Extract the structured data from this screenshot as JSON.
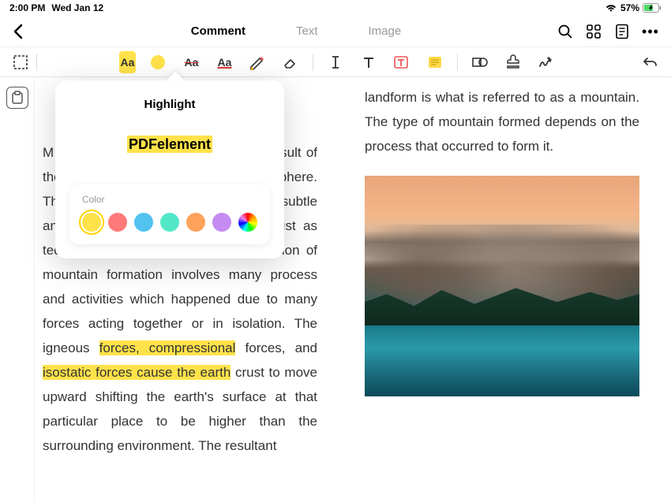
{
  "status": {
    "time": "2:00 PM",
    "date": "Wed Jan 12",
    "battery_pct": "57%"
  },
  "nav": {
    "tabs": [
      "Comment",
      "Text",
      "Image"
    ],
    "active_tab": "Comment"
  },
  "toolbar": {
    "highlight_label": "Aa",
    "strike_label": "Aa",
    "underline_label": "Aa"
  },
  "popup": {
    "title": "Highlight",
    "sample": "PDFelement",
    "color_label": "Color",
    "colors": [
      "#ffe24a",
      "#ff7a7a",
      "#52c2f1",
      "#52e8c7",
      "#ffa25b",
      "#c58bf2"
    ]
  },
  "doc": {
    "left_pre": "M phenomenon in which the highest result of the landmass is projected to form the sphere. These processes are associated with subtle and large-scale movements of the crust as tectonic plates. The formation or creation of mountain formation involves many process and activities which happened due to many forces acting together or in isolation. The igneous ",
    "left_hl1": "forces, compressional",
    "left_mid": " forces, and ",
    "left_hl2": "isostatic forces cause the earth",
    "left_post": " crust to move upward shifting the earth's surface at that particular place to be higher than the surrounding environment. The resultant",
    "right": "landform is what is referred to as a mountain. The type of mountain formed depends on the process that occurred to form it."
  }
}
